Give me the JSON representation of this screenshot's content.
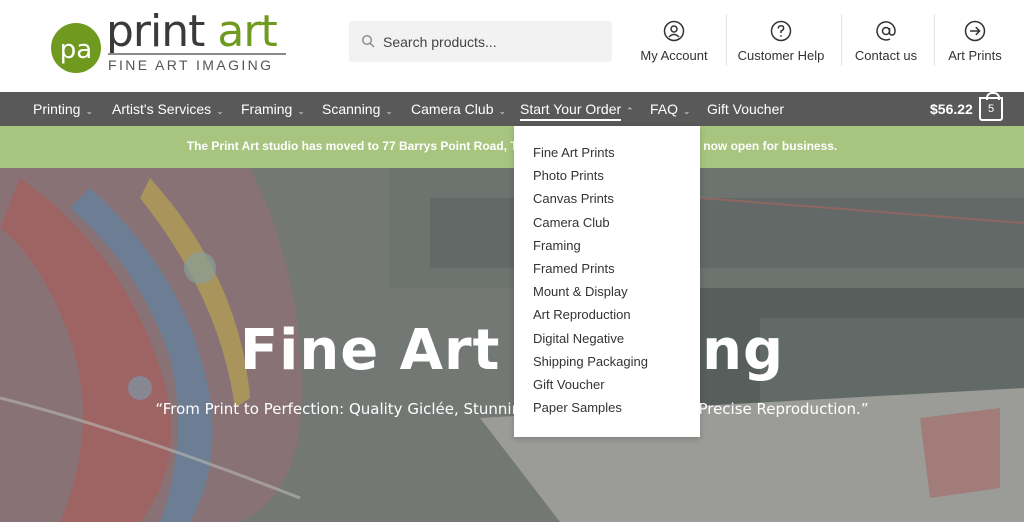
{
  "logo": {
    "mark": "pa",
    "word_primary": "print",
    "word_accent": "art",
    "tagline": "FINE ART IMAGING"
  },
  "search": {
    "placeholder": "Search products..."
  },
  "header_links": [
    {
      "label": "My Account",
      "icon": "user-icon"
    },
    {
      "label": "Customer Help",
      "icon": "help-icon"
    },
    {
      "label": "Contact us",
      "icon": "at-icon"
    },
    {
      "label": "Art Prints",
      "icon": "arrow-right-circle-icon"
    }
  ],
  "nav": {
    "items": [
      {
        "label": "Printing",
        "chevron": "⌄"
      },
      {
        "label": "Artist's Services",
        "chevron": "⌄"
      },
      {
        "label": "Framing",
        "chevron": "⌄"
      },
      {
        "label": "Scanning",
        "chevron": "⌄"
      },
      {
        "label": "Camera Club",
        "chevron": "⌄"
      },
      {
        "label": "Start Your Order",
        "chevron": "⌃"
      },
      {
        "label": "FAQ",
        "chevron": "⌄"
      },
      {
        "label": "Gift Voucher",
        "chevron": ""
      }
    ],
    "cart_total": "$56.22",
    "cart_count": "5"
  },
  "notice": "The Print Art studio has moved to 77 Barrys Point Road, Takapuna. We t... rt. The studio is now open for business.",
  "hero": {
    "title": "Fine Art Imaging",
    "subtitle": "“From Print to Perfection: Quality Giclée, Stunning Canvas, Framing and Precise Reproduction.”"
  },
  "dropdown": {
    "items": [
      "Fine Art Prints",
      "Photo Prints",
      "Canvas Prints",
      "Camera Club",
      "Framing",
      "Framed Prints",
      "Mount & Display",
      "Art Reproduction",
      "Digital Negative",
      "Shipping Packaging",
      "Gift Voucher",
      "Paper Samples"
    ]
  },
  "colors": {
    "brand_green": "#6f9a1f",
    "nav_bg": "#595959",
    "notice_bg": "#a7c57e"
  }
}
